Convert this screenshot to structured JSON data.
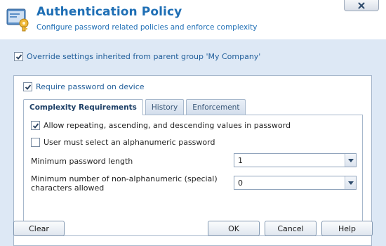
{
  "header": {
    "title": "Authentication Policy",
    "subtitle": "Configure password related policies and enforce complexity",
    "icon": "security-policy-icon",
    "close_icon": "close-icon"
  },
  "override": {
    "label": "Override settings inherited from parent group 'My Company'",
    "checked": true
  },
  "require_password": {
    "label": "Require password on device",
    "checked": true
  },
  "tabs": [
    {
      "label": "Complexity Requirements",
      "active": true
    },
    {
      "label": "History",
      "active": false
    },
    {
      "label": "Enforcement",
      "active": false
    }
  ],
  "options": {
    "allow_repeating": {
      "label": "Allow repeating, ascending, and descending values in password",
      "checked": true
    },
    "alphanumeric": {
      "label": "User must select an alphanumeric password",
      "checked": false
    }
  },
  "fields": {
    "min_length": {
      "label": "Minimum password length",
      "value": "1"
    },
    "min_special": {
      "label_line1": "Minimum number of non-alphanumeric (special)",
      "label_line2": "characters allowed",
      "value": "0"
    }
  },
  "buttons": {
    "clear": "Clear",
    "ok": "OK",
    "cancel": "Cancel",
    "help": "Help"
  },
  "colors": {
    "accent": "#1f6fb5",
    "background": "#dde8f5"
  }
}
